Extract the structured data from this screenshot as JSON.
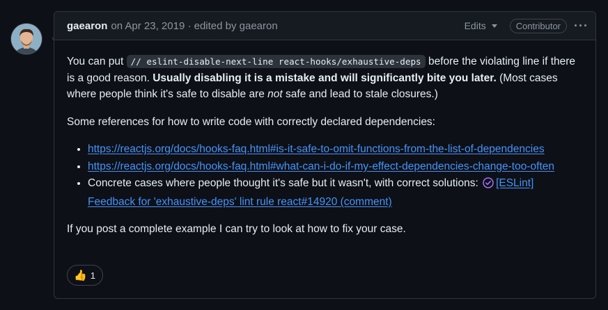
{
  "header": {
    "author": "gaearon",
    "meta": "on Apr 23, 2019 · edited by gaearon",
    "edits_label": "Edits",
    "badge": "Contributor",
    "more_icon": "kebab-horizontal-icon"
  },
  "body": {
    "p1_before": "You can put ",
    "p1_code": "// eslint-disable-next-line react-hooks/exhaustive-deps",
    "p1_after": " before the violating line if there is a good reason. ",
    "p1_bold": "Usually disabling it is a mistake and will significantly bite you later.",
    "p1_rest1": " (Most cases where people think it's safe to disable are ",
    "p1_italic": "not",
    "p1_rest2": " safe and lead to stale closures.)",
    "p2": "Some references for how to write code with correctly declared dependencies:",
    "links": [
      "https://reactjs.org/docs/hooks-faq.html#is-it-safe-to-omit-functions-from-the-list-of-dependencies",
      "https://reactjs.org/docs/hooks-faq.html#what-can-i-do-if-my-effect-dependencies-change-too-often"
    ],
    "li3_text": "Concrete cases where people thought it's safe but it wasn't, with correct solutions: ",
    "li3_link": "[ESLint] Feedback for 'exhaustive-deps' lint rule react#14920 (comment)",
    "p3": "If you post a complete example I can try to look at how to fix your case."
  },
  "reaction": {
    "emoji": "👍",
    "count": "1"
  },
  "colors": {
    "link": "#4493f8",
    "check": "#a371f7",
    "header_bg": "#161b22",
    "page_bg": "#0d1117"
  }
}
